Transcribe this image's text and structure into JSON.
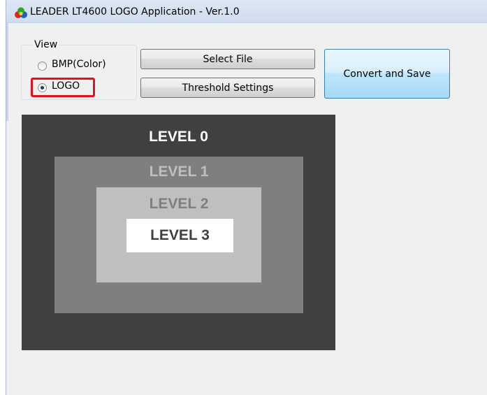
{
  "window": {
    "title": "LEADER LT4600 LOGO Application - Ver.1.0"
  },
  "view_group": {
    "legend": "View",
    "options": [
      {
        "label": "BMP(Color)",
        "selected": false
      },
      {
        "label": "LOGO",
        "selected": true
      }
    ]
  },
  "buttons": {
    "select_file": "Select File",
    "threshold_settings": "Threshold Settings",
    "convert_and_save": "Convert and Save"
  },
  "preview": {
    "levels": [
      {
        "label": "LEVEL 0",
        "fill": "#404040",
        "text_color": "#ffffff"
      },
      {
        "label": "LEVEL 1",
        "fill": "#7f7f7f",
        "text_color": "#bfbfbf"
      },
      {
        "label": "LEVEL 2",
        "fill": "#bfbfbf",
        "text_color": "#7f7f7f"
      },
      {
        "label": "LEVEL 3",
        "fill": "#ffffff",
        "text_color": "#404040"
      }
    ]
  },
  "colors": {
    "titlebar": "#d4e1f1",
    "window_bg": "#f0f0f0",
    "highlight": "#e0141e",
    "default_button": "#bee6fd"
  },
  "icons": {
    "app": "color-circles-icon"
  }
}
